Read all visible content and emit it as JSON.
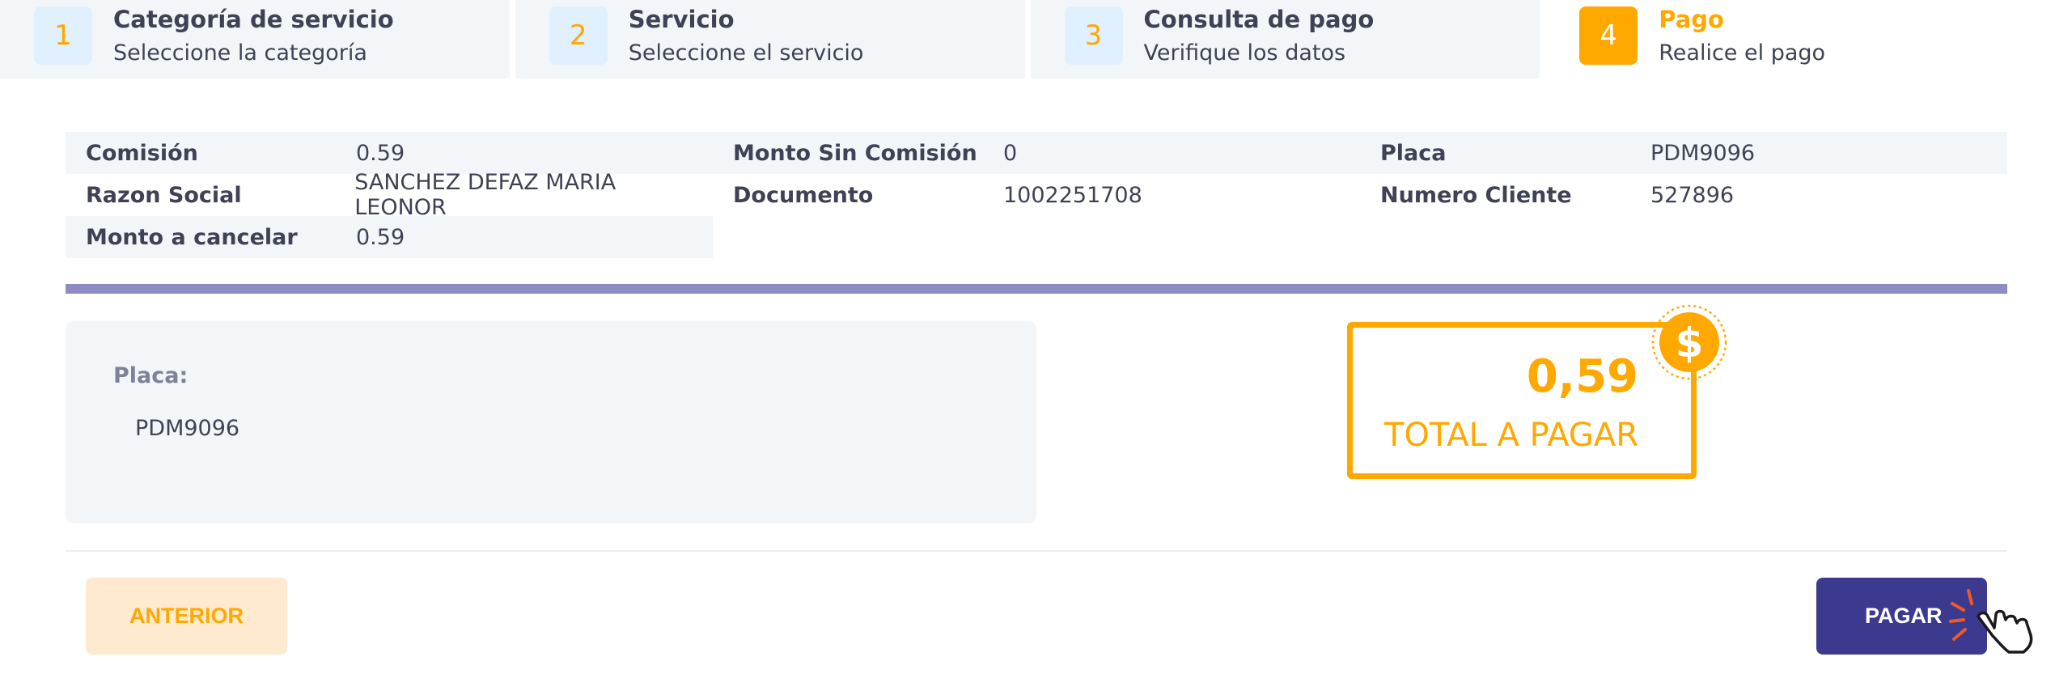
{
  "stepper": {
    "steps": [
      {
        "number": "1",
        "title": "Categoría de servicio",
        "subtitle": "Seleccione la categoría"
      },
      {
        "number": "2",
        "title": "Servicio",
        "subtitle": "Seleccione el servicio"
      },
      {
        "number": "3",
        "title": "Consulta de pago",
        "subtitle": "Verifique los datos"
      },
      {
        "number": "4",
        "title": "Pago",
        "subtitle": "Realice el pago"
      }
    ],
    "active_step": 4
  },
  "info": {
    "comision": {
      "label": "Comisión",
      "value": "0.59"
    },
    "monto_sin_comision": {
      "label": "Monto Sin Comisión",
      "value": "0"
    },
    "placa": {
      "label": "Placa",
      "value": "PDM9096"
    },
    "razon_social": {
      "label": "Razon Social",
      "value": "SANCHEZ DEFAZ MARIA LEONOR"
    },
    "documento": {
      "label": "Documento",
      "value": "1002251708"
    },
    "numero_cliente": {
      "label": "Numero Cliente",
      "value": "527896"
    },
    "monto_a_cancelar": {
      "label": "Monto a cancelar",
      "value": "0.59"
    }
  },
  "field": {
    "label": "Placa:",
    "value": "PDM9096"
  },
  "total": {
    "amount": "0,59",
    "label": "TOTAL A PAGAR",
    "currency_symbol": "$"
  },
  "buttons": {
    "previous": "ANTERIOR",
    "pay": "PAGAR"
  },
  "colors": {
    "accent": "#ffa800",
    "primary": "#3c3a8f",
    "divider": "#8c8cc3",
    "light_bg": "#f3f6f9"
  }
}
